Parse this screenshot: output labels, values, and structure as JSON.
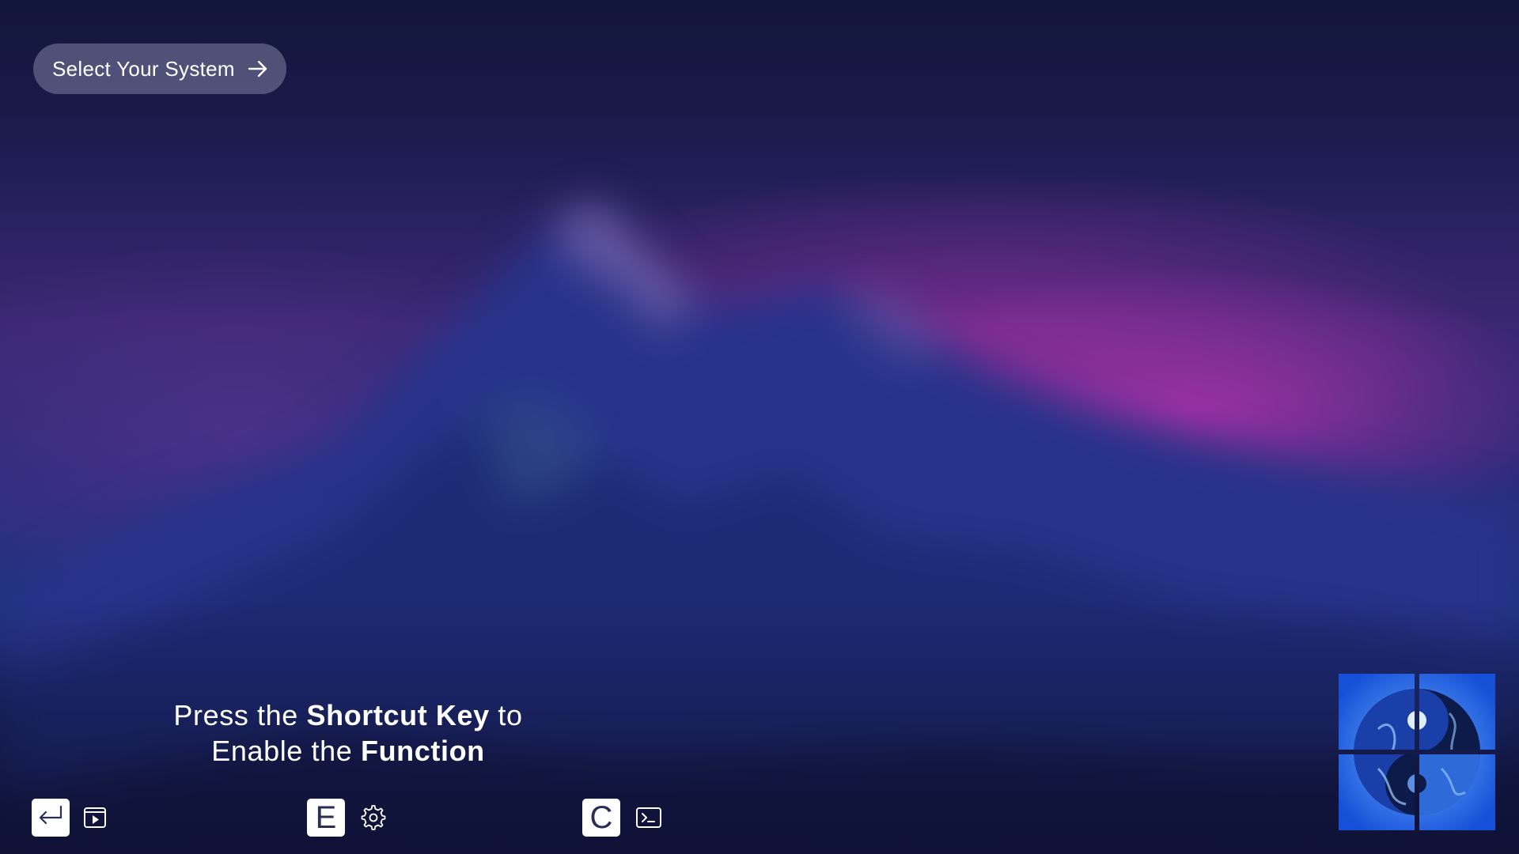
{
  "header": {
    "select_system_label": "Select Your System"
  },
  "hint": {
    "line1_prefix": "Press the ",
    "line1_bold": "Shortcut Key",
    "line1_suffix": " to",
    "line2_prefix": "Enable the ",
    "line2_bold": "Function"
  },
  "shortcuts": [
    {
      "key": "",
      "key_icon": "enter-return-icon",
      "function_icon": "play-window-icon"
    },
    {
      "key": "E",
      "function_icon": "gear-icon"
    },
    {
      "key": "C",
      "function_icon": "terminal-icon"
    }
  ],
  "logo": {
    "icon": "yin-yang-dragon-logo"
  },
  "colors": {
    "button_bg": "#9696b9",
    "text": "#ffffff",
    "key_bg": "#ffffff",
    "key_text": "#2a2d55",
    "logo_blue": "#1e6fe6"
  }
}
